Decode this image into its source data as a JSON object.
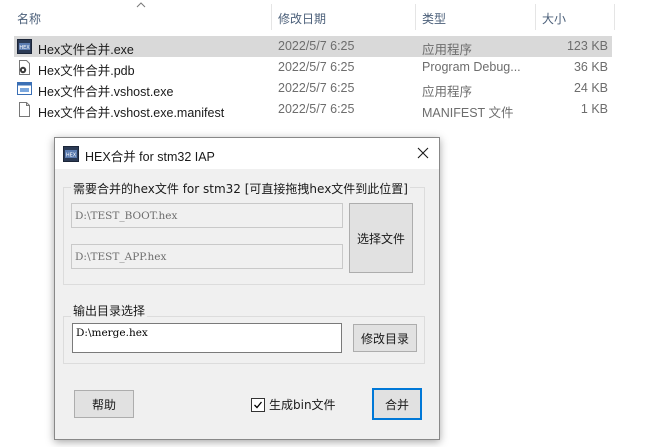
{
  "explorer": {
    "columns": {
      "name": "名称",
      "date": "修改日期",
      "type": "类型",
      "size": "大小"
    },
    "files": [
      {
        "name": "Hex文件合并.exe",
        "date": "2022/5/7 6:25",
        "type": "应用程序",
        "size": "123 KB",
        "icon": "app-exe-icon"
      },
      {
        "name": "Hex文件合并.pdb",
        "date": "2022/5/7 6:25",
        "type": "Program Debug...",
        "size": "36 KB",
        "icon": "pdb-file-icon"
      },
      {
        "name": "Hex文件合并.vshost.exe",
        "date": "2022/5/7 6:25",
        "type": "应用程序",
        "size": "24 KB",
        "icon": "window-app-icon"
      },
      {
        "name": "Hex文件合并.vshost.exe.manifest",
        "date": "2022/5/7 6:25",
        "type": "MANIFEST 文件",
        "size": "1 KB",
        "icon": "blank-file-icon"
      }
    ]
  },
  "dialog": {
    "title": "HEX合并 for stm32 IAP",
    "icon_label": "HEX",
    "input_group": {
      "label": "需要合并的hex文件 for stm32 [可直接拖拽hex文件到此位置]",
      "file1": "D:\\TEST_BOOT.hex",
      "file2": "D:\\TEST_APP.hex",
      "select_button": "选择文件"
    },
    "output_group": {
      "label": "输出目录选择",
      "path": "D:\\merge.hex",
      "modify_button": "修改目录"
    },
    "help_button": "帮助",
    "checkbox_label": "生成bin文件",
    "checkbox_checked": true,
    "merge_button": "合并"
  }
}
